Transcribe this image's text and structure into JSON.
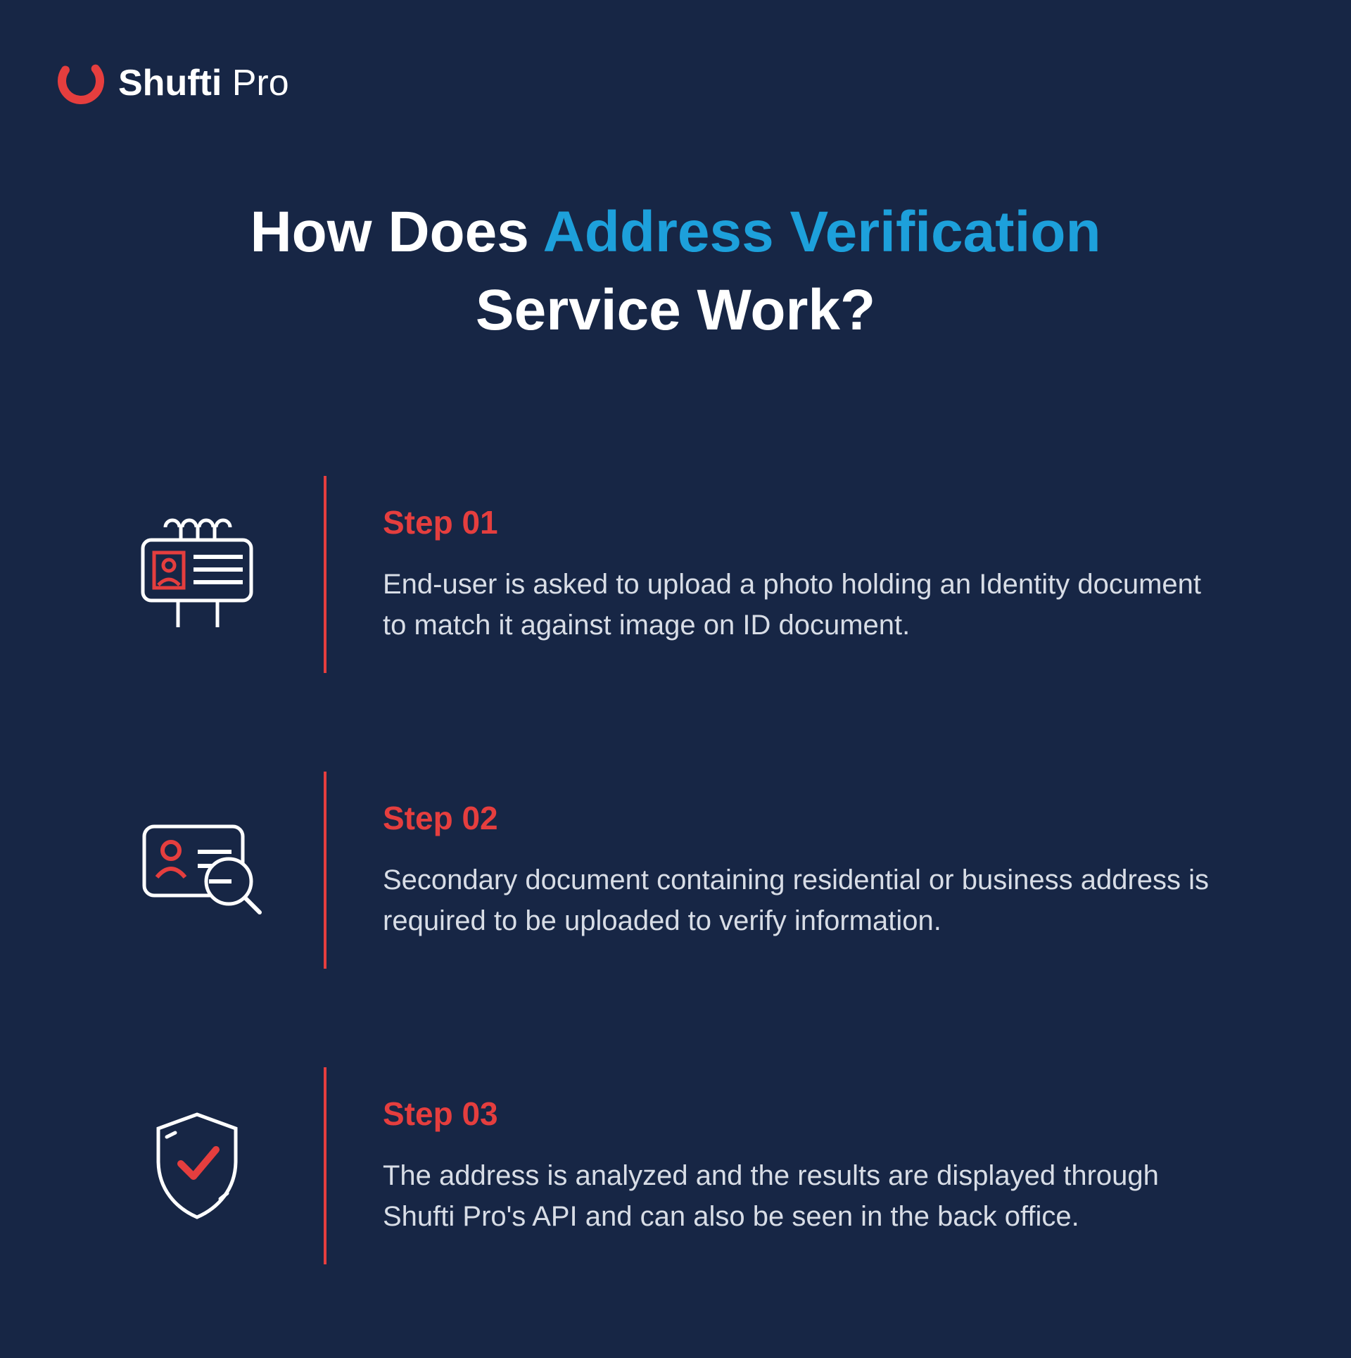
{
  "brand": {
    "name": "Shufti",
    "suffix": "Pro"
  },
  "title": {
    "prefix": "How Does ",
    "highlight": "Address Verification",
    "line2": "Service Work?"
  },
  "steps": [
    {
      "label": "Step 01",
      "desc": "End-user is asked to upload a photo holding an Identity document to match it against image on ID document."
    },
    {
      "label": "Step 02",
      "desc": "Secondary document containing residential or business address is required to be uploaded to verify information."
    },
    {
      "label": "Step 03",
      "desc": "The address is analyzed and the results are displayed through Shufti Pro's API and can also be seen in the back office."
    }
  ]
}
